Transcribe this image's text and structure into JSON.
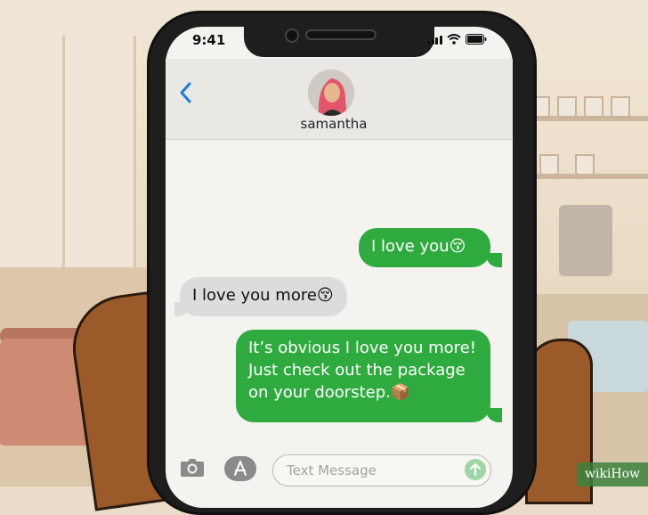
{
  "status_bar": {
    "time": "9:41"
  },
  "header": {
    "back_icon": "chevron-left-icon",
    "contact_name": "samantha"
  },
  "messages": [
    {
      "direction": "sent",
      "text": "I love you😚"
    },
    {
      "direction": "received",
      "text": "I love you more😚"
    },
    {
      "direction": "sent",
      "text": "It’s obvious I love you more! Just check out the package on your doorstep.📦"
    }
  ],
  "input_bar": {
    "camera_icon": "camera-icon",
    "apps_icon": "app-store-icon",
    "placeholder": "Text Message",
    "send_icon": "send-arrow-icon"
  },
  "colors": {
    "sent_bubble": "#2faa3f",
    "received_bubble": "#dcdcdc",
    "ios_blue": "#1f7ae0"
  },
  "watermark": "wikiHow"
}
